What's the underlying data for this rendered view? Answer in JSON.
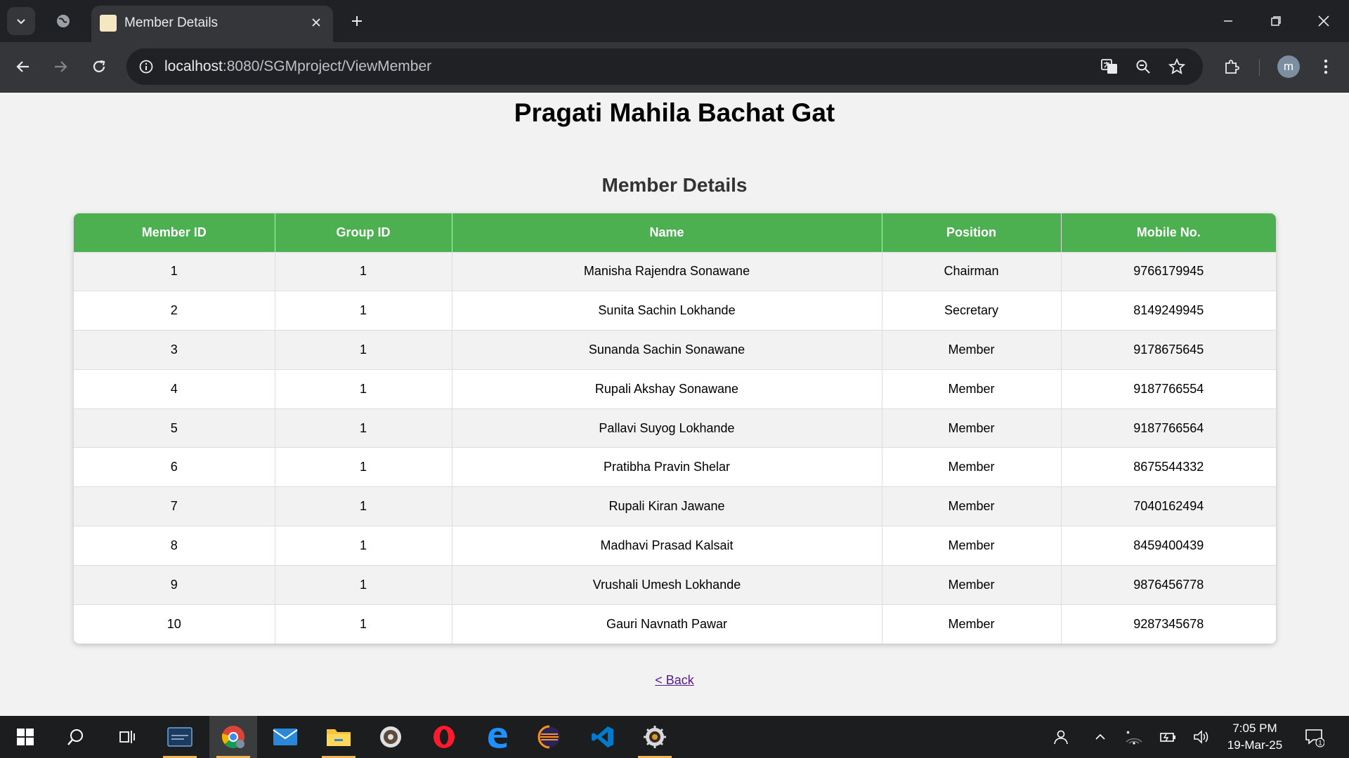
{
  "browser": {
    "tab_title": "Member Details",
    "url_host": "localhost",
    "url_path": ":8080/SGMproject/ViewMember",
    "profile_initial": "m"
  },
  "page": {
    "site_title": "Pragati Mahila Bachat Gat",
    "section_title": "Member Details",
    "back_link": "< Back",
    "table": {
      "headers": [
        "Member ID",
        "Group ID",
        "Name",
        "Position",
        "Mobile No."
      ],
      "rows": [
        [
          "1",
          "1",
          "Manisha Rajendra Sonawane",
          "Chairman",
          "9766179945"
        ],
        [
          "2",
          "1",
          "Sunita Sachin Lokhande",
          "Secretary",
          "8149249945"
        ],
        [
          "3",
          "1",
          "Sunanda Sachin Sonawane",
          "Member",
          "9178675645"
        ],
        [
          "4",
          "1",
          "Rupali Akshay Sonawane",
          "Member",
          "9187766554"
        ],
        [
          "5",
          "1",
          "Pallavi Suyog Lokhande",
          "Member",
          "9187766564"
        ],
        [
          "6",
          "1",
          "Pratibha Pravin Shelar",
          "Member",
          "8675544332"
        ],
        [
          "7",
          "1",
          "Rupali Kiran Jawane",
          "Member",
          "7040162494"
        ],
        [
          "8",
          "1",
          "Madhavi Prasad Kalsait",
          "Member",
          "8459400439"
        ],
        [
          "9",
          "1",
          "Vrushali Umesh Lokhande",
          "Member",
          "9876456778"
        ],
        [
          "10",
          "1",
          "Gauri Navnath Pawar",
          "Member",
          "9287345678"
        ]
      ]
    }
  },
  "taskbar": {
    "apps": [
      "start-icon",
      "search-icon",
      "task-view-icon",
      "mysql-workbench-icon",
      "chrome-icon",
      "mail-icon",
      "file-explorer-icon",
      "media-player-icon",
      "opera-icon",
      "edge-icon",
      "eclipse-icon",
      "vscode-icon",
      "settings-gear-icon"
    ],
    "time": "7:05 PM",
    "date": "19-Mar-25",
    "notification_count": "1"
  },
  "colors": {
    "header_green": "#4caf50",
    "chrome_dark": "#202124",
    "toolbar": "#35363a",
    "link": "#551a8b"
  }
}
